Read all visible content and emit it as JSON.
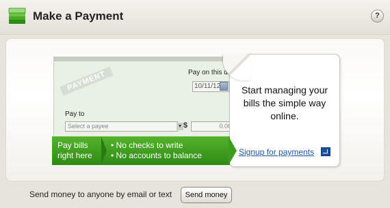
{
  "header": {
    "title": "Make a Payment",
    "help_label": "?"
  },
  "check": {
    "watermark": "PAYMENT",
    "pay_date_label": "Pay on this date",
    "date_value": "10/11/12",
    "pay_to_label": "Pay to",
    "payee_placeholder": "Select a payee",
    "currency_symbol": "$",
    "amount_value": "0.00"
  },
  "banner": {
    "left_text": "Pay bills right here",
    "bullets": [
      "• No checks to write",
      "• No accounts to balance"
    ]
  },
  "callout": {
    "text": "Start managing your bills the simple way online.",
    "signup_link": "Signup for payments"
  },
  "footer": {
    "send_text": "Send money to anyone by email or text",
    "send_button": "Send money"
  },
  "colors": {
    "accent_green": "#3e9d1f",
    "link_blue": "#1f57a8"
  }
}
